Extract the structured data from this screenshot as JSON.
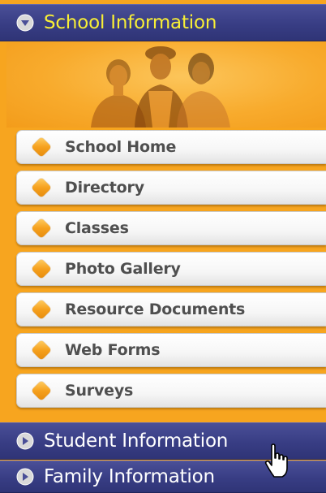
{
  "sections": {
    "school": {
      "label": "School Information",
      "icon": "chevron-down-circle-icon",
      "state": "expanded"
    },
    "student": {
      "label": "Student Information",
      "icon": "chevron-right-circle-icon",
      "state": "collapsed"
    },
    "family": {
      "label": "Family Information",
      "icon": "chevron-right-circle-icon",
      "state": "collapsed"
    }
  },
  "menu": {
    "items": [
      {
        "label": "School Home"
      },
      {
        "label": "Directory"
      },
      {
        "label": "Classes"
      },
      {
        "label": "Photo Gallery"
      },
      {
        "label": "Resource Documents"
      },
      {
        "label": "Web Forms"
      },
      {
        "label": "Surveys"
      }
    ],
    "bullet_icon": "orange-diamond-bullet-icon"
  },
  "colors": {
    "header_bg": "#383d84",
    "active_header_text": "#f8ef36",
    "header_text": "#ffffff",
    "panel_bg": "#f7a51f",
    "item_text": "#4f4f4f"
  }
}
